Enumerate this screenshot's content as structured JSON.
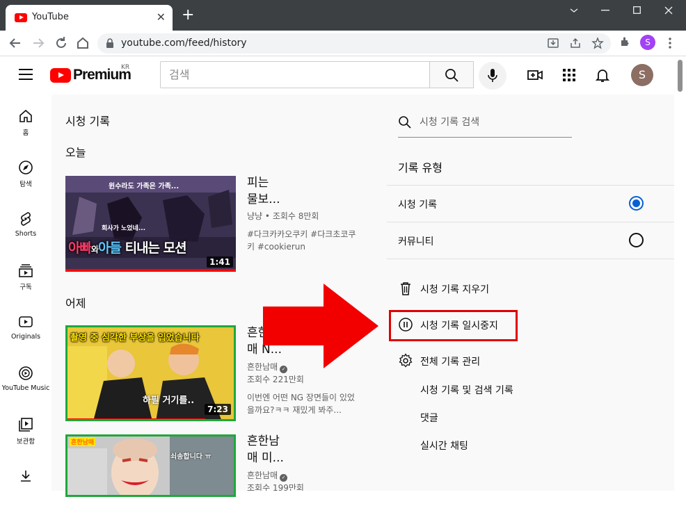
{
  "browser": {
    "tab_title": "YouTube",
    "tab_close": "✕",
    "new_tab": "+",
    "url": "youtube.com/feed/history",
    "profile_initial": "S"
  },
  "header": {
    "logo_text": "Premium",
    "country_code": "KR",
    "search_placeholder": "검색",
    "avatar_initial": "S"
  },
  "sidebar": {
    "items": [
      {
        "label": "홈",
        "icon": "home-icon"
      },
      {
        "label": "탐색",
        "icon": "compass-icon"
      },
      {
        "label": "Shorts",
        "icon": "shorts-icon"
      },
      {
        "label": "구독",
        "icon": "subscriptions-icon"
      },
      {
        "label": "Originals",
        "icon": "originals-icon"
      },
      {
        "label": "YouTube Music",
        "icon": "music-icon"
      },
      {
        "label": "보관함",
        "icon": "library-icon"
      },
      {
        "label": "",
        "icon": "download-icon"
      }
    ]
  },
  "main": {
    "title": "시청 기록",
    "sections": [
      {
        "heading": "오늘"
      },
      {
        "heading": "어제"
      }
    ],
    "videos": [
      {
        "thumb_text_top": "윈수라도 가족은 가족...",
        "thumb_text_mid": "회사가 노었네...",
        "thumb_text_main_a": "아빠",
        "thumb_text_main_b": "와",
        "thumb_text_main_c": "아들",
        "thumb_text_main_d": " 티내는 ",
        "thumb_text_main_e": "모션",
        "duration": "1:41",
        "progress": 1.0,
        "title_line1": "피는",
        "title_line2": "물보...",
        "channel": "냥냥",
        "views": "조회수 8만회",
        "desc": "#다크카카오쿠키 #다크초코쿠키 #cookierun"
      },
      {
        "thumb_text": "촬영 중 심각한 부상을 입었습니다",
        "thumb_sub": "하필 거기를..",
        "duration": "7:23",
        "progress": 0.84,
        "title_line1": "흔한",
        "title_line2": "매 N...",
        "channel": "흔한남매",
        "views": "조회수 221만회",
        "desc": "이번엔 어떤 NG 장면들이 있었을까요?ㅋㅋ 재밌게 봐주..."
      },
      {
        "thumb_badge": "흔한남매",
        "thumb_sub": "쇠송합니다 ㅠ",
        "title_line1": "흔한남",
        "title_line2": "매 미...",
        "channel": "흔한남매",
        "views": "조회수 199만회"
      }
    ]
  },
  "panel": {
    "search_placeholder": "시청 기록 검색",
    "history_type_heading": "기록 유형",
    "options": [
      {
        "label": "시청 기록",
        "selected": true
      },
      {
        "label": "커뮤니티",
        "selected": false
      }
    ],
    "actions": [
      {
        "label": "시청 기록 지우기",
        "icon": "trash-icon"
      },
      {
        "label": "시청 기록 일시중지",
        "icon": "pause-circle-icon"
      },
      {
        "label": "전체 기록 관리",
        "icon": "gear-icon"
      }
    ],
    "sublinks": [
      "시청 기록 및 검색 기록",
      "댓글",
      "실시간 채팅"
    ]
  },
  "colors": {
    "accent_blue": "#065fd4",
    "youtube_red": "#ff0000",
    "annotation_red": "#e00000"
  }
}
